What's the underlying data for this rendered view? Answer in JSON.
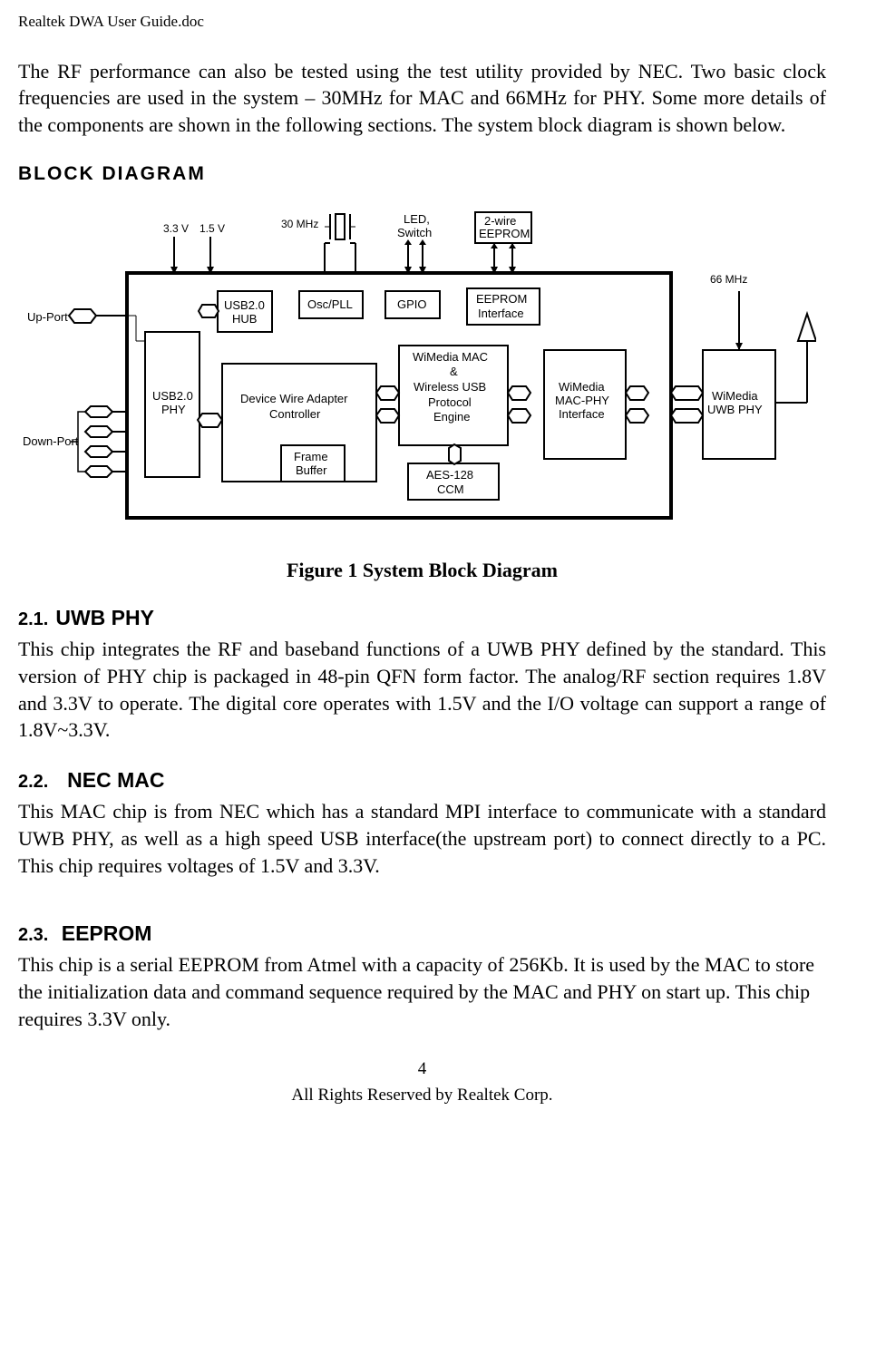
{
  "header": {
    "doc_title": "Realtek DWA User Guide.doc"
  },
  "intro": {
    "text": "The RF performance can also be tested using the test utility provided by NEC. Two basic clock frequencies are used in the system – 30MHz for MAC and 66MHz for PHY. Some more details of the components are shown in the following sections. The system block diagram is shown below."
  },
  "diagram": {
    "top_title": "BLOCK  DIAGRAM",
    "labels": {
      "vin1": "3.3 V",
      "vin2": "1.5 V",
      "clk30": "30 MHz",
      "led": "LED,",
      "switch": "Switch",
      "eeprom2w": "2-wire",
      "eeprom2w2": "EEPROM",
      "phy66": "66 MHz",
      "upport": "Up-Port",
      "downport": "Down-Port",
      "usb2phy1": "USB2.0",
      "usb2phy2": "PHY",
      "usb2hub1": "USB2.0",
      "usb2hub2": "HUB",
      "oscpll": "Osc/PLL",
      "gpio": "GPIO",
      "eei1": "EEPROM",
      "eei2": "Interface",
      "dwac1": "Device Wire Adapter",
      "dwac2": "Controller",
      "fb1": "Frame",
      "fb2": "Buffer",
      "wimac1": "WiMedia MAC",
      "wimac2": "&",
      "wimac3": "Wireless USB",
      "wimac4": "Protocol",
      "wimac5": "Engine",
      "aes1": "AES-128",
      "aes2": "CCM",
      "wmpi1": "WiMedia",
      "wmpi2": "MAC-PHY",
      "wmpi3": "Interface",
      "uwb1": "WiMedia",
      "uwb2": "UWB PHY"
    }
  },
  "figure_caption": "Figure 1 System Block Diagram",
  "sections": {
    "s1": {
      "heading_num": "2.1.",
      "heading_text": "UWB PHY",
      "body": "This chip integrates the RF and baseband functions of a UWB PHY defined by the standard. This version of PHY chip is packaged in 48-pin QFN form factor. The analog/RF section requires 1.8V and 3.3V to operate. The digital core operates with 1.5V and the I/O voltage can support a range of 1.8V~3.3V."
    },
    "s2": {
      "heading_num": "2.2.",
      "heading_text": "NEC MAC",
      "body": "This MAC chip is from NEC which has a standard MPI interface to communicate with a standard UWB PHY, as well as a high speed USB interface(the upstream port) to connect directly to a PC. This chip requires voltages of 1.5V and 3.3V."
    },
    "s3": {
      "heading_num": "2.3.",
      "heading_text": "EEPROM",
      "body": "This chip is a serial EEPROM from Atmel with a capacity of 256Kb. It is used by the MAC to store the initialization data and command sequence required by the MAC and PHY on start up. This chip requires 3.3V only."
    }
  },
  "footer": {
    "page": "4",
    "rights": "All Rights Reserved by Realtek Corp."
  },
  "chart_data": {
    "type": "diagram",
    "title": "System Block Diagram",
    "external_signals": {
      "voltages_in": [
        "3.3 V",
        "1.5 V"
      ],
      "clock_mac": "30 MHz",
      "gpio_peripherals": [
        "LED",
        "Switch"
      ],
      "eeprom_external": "2-wire EEPROM",
      "phy_clock": "66 MHz",
      "usb_up_port": "Up-Port",
      "usb_down_ports": "Down-Port (x4)",
      "antenna": true
    },
    "blocks": [
      "USB2.0 PHY",
      "USB2.0 HUB",
      "Osc/PLL",
      "GPIO",
      "EEPROM Interface",
      "Device Wire Adapter Controller",
      "Frame Buffer",
      "WiMedia MAC & Wireless USB Protocol Engine",
      "AES-128 CCM",
      "WiMedia MAC-PHY Interface",
      "WiMedia UWB PHY"
    ],
    "connections": [
      [
        "Up-Port",
        "USB2.0 PHY"
      ],
      [
        "Down-Port",
        "USB2.0 PHY"
      ],
      [
        "USB2.0 PHY",
        "USB2.0 HUB"
      ],
      [
        "USB2.0 HUB",
        "Device Wire Adapter Controller"
      ],
      [
        "Device Wire Adapter Controller",
        "Frame Buffer"
      ],
      [
        "Device Wire Adapter Controller",
        "WiMedia MAC & Wireless USB Protocol Engine"
      ],
      [
        "WiMedia MAC & Wireless USB Protocol Engine",
        "AES-128 CCM"
      ],
      [
        "WiMedia MAC & Wireless USB Protocol Engine",
        "WiMedia MAC-PHY Interface"
      ],
      [
        "WiMedia MAC-PHY Interface",
        "WiMedia UWB PHY"
      ],
      [
        "WiMedia UWB PHY",
        "Antenna"
      ],
      [
        "2-wire EEPROM",
        "EEPROM Interface"
      ],
      [
        "30 MHz",
        "Osc/PLL"
      ],
      [
        "LED,Switch",
        "GPIO"
      ],
      [
        "66 MHz",
        "WiMedia UWB PHY"
      ]
    ]
  }
}
